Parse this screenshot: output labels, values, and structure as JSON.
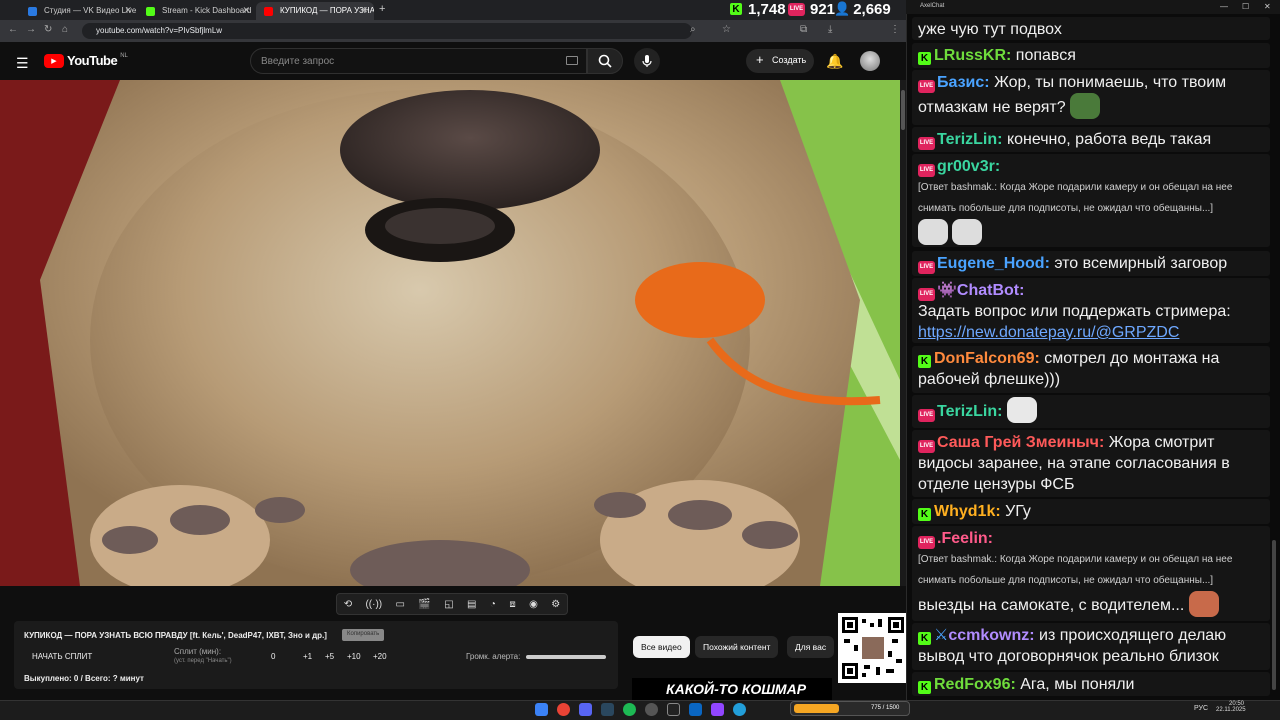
{
  "tabs": [
    {
      "label": "Студия — VK Видео Live",
      "color": "#2a7ae2"
    },
    {
      "label": "Stream - Kick Dashboard",
      "color": "#53fc18"
    },
    {
      "label": "КУПИКОД — ПОРА УЗНАТЬ ВСЮ ПРАВДУ",
      "color": "#ff0000"
    }
  ],
  "browser": {
    "url": "youtube.com/watch?v=PIvSbfjlmLw"
  },
  "counters": {
    "kick": "1,748",
    "vk": "921",
    "viewers": "2,669"
  },
  "youtube": {
    "logo": "YouTube",
    "region": "NL",
    "search_placeholder": "Введите запрос",
    "create_label": "Создать"
  },
  "panel": {
    "title": "КУПИКОД — ПОРА УЗНАТЬ ВСЮ ПРАВДУ [ft. Кель', DeadP47, IXBT, Зно и др.]",
    "copy_label": "Копировать",
    "start_split": "НАЧАТЬ СПЛИТ",
    "split_label": "Сплит (мин):",
    "split_hint": "(уст. перед \"Начать\")",
    "split_value": "0",
    "increments": [
      "+1",
      "+5",
      "+10",
      "+20"
    ],
    "volume_label": "Громк. алерта:",
    "bought": "Выкуплено: 0 / Всего: ? минут"
  },
  "filters": [
    "Все видео",
    "Похожий контент",
    "Для вас"
  ],
  "thumb_caption": "КАКОЙ-ТО КОШМАР",
  "chat": {
    "window_title": "AxelChat",
    "messages": [
      {
        "type": "none",
        "nick": "",
        "nick_color": "",
        "text": "уже чую тут подвох"
      },
      {
        "type": "kick",
        "nick": "LRussKR:",
        "nick_color": "#6fdc3c",
        "text": "попався"
      },
      {
        "type": "vk",
        "nick": "Базис:",
        "nick_color": "#4aa3ff",
        "text": "Жор, ты понимаешь, что твоим отмазкам не верят?"
      },
      {
        "type": "vk",
        "nick": "TerizLin:",
        "nick_color": "#3ad6a0",
        "text": "конечно, работа ведь такая"
      },
      {
        "type": "vk",
        "nick": "gr00v3r:",
        "nick_color": "#3ad6a0",
        "reply": "[Ответ bashmak.: Когда Жоре подарили камеру и он обещал на нее снимать побольше для подписоты, не ожидал что обещанны...]"
      },
      {
        "type": "vk",
        "nick": "Eugene_Hood:",
        "nick_color": "#4aa3ff",
        "text": "это всемирный заговор"
      },
      {
        "type": "vk",
        "nick": "ChatBot:",
        "nick_color": "#b18cff",
        "text": "Задать вопрос или поддержать стримера:",
        "link": "https://new.donatepay.ru/@GRPZDC"
      },
      {
        "type": "kick",
        "nick": "DonFalcon69:",
        "nick_color": "#ff8a3d",
        "text": "смотрел до монтажа на рабочей флешке)))"
      },
      {
        "type": "vk",
        "nick": "TerizLin:",
        "nick_color": "#3ad6a0",
        "text": ""
      },
      {
        "type": "vk",
        "nick": "Саша Грей Змеиныч:",
        "nick_color": "#ff5a5a",
        "text": "Жора смотрит видосы заранее, на этапе согласования в отделе цензуры ФСБ"
      },
      {
        "type": "kick",
        "nick": "Whyd1k:",
        "nick_color": "#ffb020",
        "text": "УГу"
      },
      {
        "type": "vk",
        "nick": ".Feelin:",
        "nick_color": "#ff5a8a",
        "reply": "[Ответ bashmak.: Когда Жоре подарили камеру и он обещал на нее снимать побольше для подписоты, не ожидал что обещанны...]",
        "text": "выезды на самокате, с водителем..."
      },
      {
        "type": "kick",
        "nick": "ccmkownz:",
        "nick_color": "#b18cff",
        "text": "из происходящего делаю вывод что договорнячок реально близок"
      },
      {
        "type": "kick",
        "nick": "RedFox96:",
        "nick_color": "#6fdc3c",
        "text": "Ага, мы поняли"
      }
    ]
  },
  "taskbar": {
    "lang": "РУС",
    "time": "20:50",
    "date": "22.11.2025",
    "progress": "775 / 1500"
  }
}
